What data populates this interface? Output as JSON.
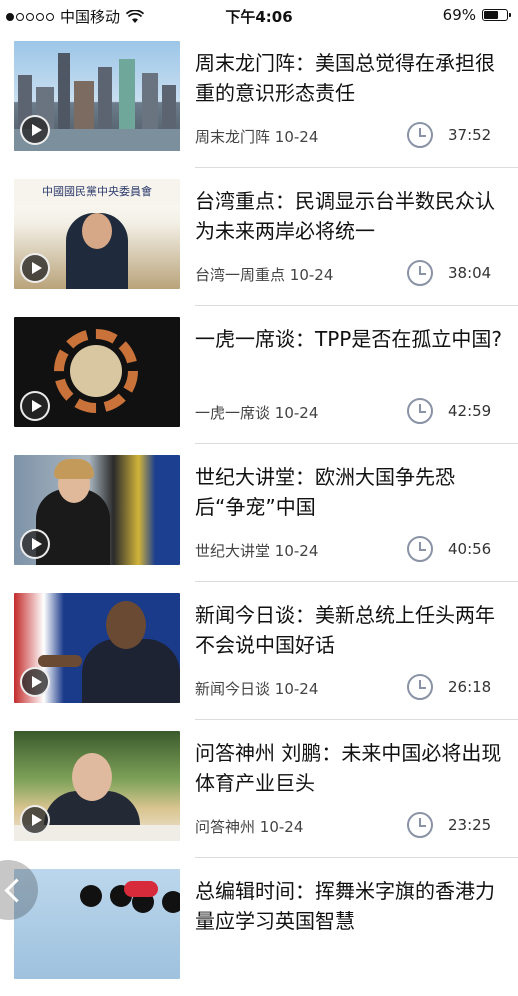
{
  "status_bar": {
    "carrier": "中国移动",
    "time": "下午4:06",
    "battery_percent": "69%",
    "battery_level": 0.69,
    "signal_bars_filled": 1,
    "signal_bars_total": 5
  },
  "icons": {
    "play": "play-icon",
    "clock": "clock-icon",
    "back": "back-arrow-icon",
    "wifi": "wifi-icon",
    "battery": "battery-icon"
  },
  "colors": {
    "clock_icon": "#8a93a6",
    "divider": "#dcdcdc"
  },
  "items": [
    {
      "title": "周末龙门阵：美国总觉得在承担很重的意识形态责任",
      "source": "周末龙门阵",
      "date": "10-24",
      "duration": "37:52"
    },
    {
      "title": "台湾重点：民调显示台半数民众认为未来两岸必将统一",
      "source": "台湾一周重点",
      "date": "10-24",
      "duration": "38:04",
      "thumb_text": "中國國民黨中央委員會"
    },
    {
      "title": "一虎一席谈：TPP是否在孤立中国?",
      "source": "一虎一席谈",
      "date": "10-24",
      "duration": "42:59"
    },
    {
      "title": "世纪大讲堂：欧洲大国争先恐后“争宠”中国",
      "source": "世纪大讲堂",
      "date": "10-24",
      "duration": "40:56"
    },
    {
      "title": "新闻今日谈：美新总统上任头两年不会说中国好话",
      "source": "新闻今日谈",
      "date": "10-24",
      "duration": "26:18"
    },
    {
      "title": "问答神州 刘鹏：未来中国必将出现体育产业巨头",
      "source": "问答神州",
      "date": "10-24",
      "duration": "23:25"
    },
    {
      "title": "总编辑时间：挥舞米字旗的香港力量应学习英国智慧",
      "source": "",
      "date": "",
      "duration": ""
    }
  ]
}
